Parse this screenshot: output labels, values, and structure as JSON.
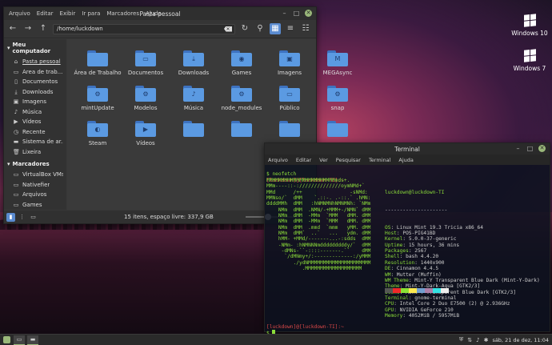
{
  "desktop": {
    "icons": [
      {
        "label": "Windows 10"
      },
      {
        "label": "Windows 7"
      }
    ]
  },
  "file_manager": {
    "title": "Pasta pessoal",
    "menu": [
      "Arquivo",
      "Editar",
      "Exibir",
      "Ir para",
      "Marcadores",
      "Ajuda"
    ],
    "path": "/home/luckdown",
    "sidebar": {
      "computer_header": "Meu computador",
      "computer_items": [
        {
          "label": "Pasta pessoal",
          "icon": "home-icon"
        },
        {
          "label": "Área de trab...",
          "icon": "desktop-icon"
        },
        {
          "label": "Documentos",
          "icon": "document-icon"
        },
        {
          "label": "Downloads",
          "icon": "download-icon"
        },
        {
          "label": "Imagens",
          "icon": "image-icon"
        },
        {
          "label": "Música",
          "icon": "music-icon"
        },
        {
          "label": "Vídeos",
          "icon": "video-icon"
        },
        {
          "label": "Recente",
          "icon": "clock-icon"
        },
        {
          "label": "Sistema de ar...",
          "icon": "drive-icon"
        },
        {
          "label": "Lixeira",
          "icon": "trash-icon"
        }
      ],
      "bookmarks_header": "Marcadores",
      "bookmark_items": [
        {
          "label": "VirtualBox VMs",
          "icon": "folder-icon"
        },
        {
          "label": "Nativefier",
          "icon": "folder-icon"
        },
        {
          "label": "Arquivos",
          "icon": "folder-icon"
        },
        {
          "label": "Games",
          "icon": "folder-icon"
        }
      ]
    },
    "files": [
      {
        "name": "Área de Trabalho",
        "emblem": ""
      },
      {
        "name": "Documentos",
        "emblem": "▭"
      },
      {
        "name": "Downloads",
        "emblem": "⤓"
      },
      {
        "name": "Games",
        "emblem": "◉"
      },
      {
        "name": "Imagens",
        "emblem": "▣"
      },
      {
        "name": "MEGAsync",
        "emblem": "M"
      },
      {
        "name": "mintUpdate",
        "emblem": "⚙"
      },
      {
        "name": "Modelos",
        "emblem": "⚙"
      },
      {
        "name": "Música",
        "emblem": "♪"
      },
      {
        "name": "node_modules",
        "emblem": "⚙"
      },
      {
        "name": "Público",
        "emblem": "▭"
      },
      {
        "name": "snap",
        "emblem": "⚙"
      },
      {
        "name": "Steam",
        "emblem": "◐"
      },
      {
        "name": "Vídeos",
        "emblem": "▶"
      },
      {
        "name": "",
        "emblem": ""
      },
      {
        "name": "",
        "emblem": ""
      },
      {
        "name": "",
        "emblem": ""
      },
      {
        "name": "",
        "emblem": ""
      }
    ],
    "status": "15 itens, espaço livre: 337,9 GB"
  },
  "terminal": {
    "title": "Terminal",
    "menu": [
      "Arquivo",
      "Editar",
      "Ver",
      "Pesquisar",
      "Terminal",
      "Ajuda"
    ],
    "prompt_line1": "[luckdown]@[luckdown-TI]:~",
    "command": "$ neofetch",
    "ascii": [
      "MMMMMMMMMMMMMMMMMMMMMMMmds+.",
      "MMm----::-://////////////oymNMd+`",
      "MMd      /++                -sNMd:",
      "MMNso/`  dMM    `.::-. .-::.` .hMN:",
      "ddddMMh  dMM   :hNMNMNhNMNMNh: `NMm",
      "    NMm  dMM  .NMN/-+MMM+-/NMN` dMM",
      "    NMm  dMM  -MMm  `MMM   dMM. dMM",
      "    NMm  dMM  -MMm  `MMM   dMM. dMM",
      "    NMm  dMM  .mmd  `mmm   yMM. dMM",
      "    NMm  dMM`  ..`   ...   ydm. dMM",
      "    hMM- +MMd/-------...-:sdds  dMM",
      "    -NMm- :hNMNNNmdddddddddy/`  dMM",
      "     -dMNs-``-::::-------.``    dMM",
      "      `/dMNmy+/:-------------:/yMMM",
      "         ./ydNMMMMMMMMMMMMMMMMMMMMM",
      "            .MMMMMMMMMMMMMMMMMMM"
    ],
    "user_host": "luckdown@luckdown-TI",
    "separator": "---------------------",
    "info": [
      {
        "key": "OS",
        "value": "Linux Mint 19.3 Tricia x86_64"
      },
      {
        "key": "Host",
        "value": "POS-PIG41BD"
      },
      {
        "key": "Kernel",
        "value": "5.0.0-37-generic"
      },
      {
        "key": "Uptime",
        "value": "15 hours, 36 mins"
      },
      {
        "key": "Packages",
        "value": "2567"
      },
      {
        "key": "Shell",
        "value": "bash 4.4.20"
      },
      {
        "key": "Resolution",
        "value": "1440x900"
      },
      {
        "key": "DE",
        "value": "Cinnamon 4.4.5"
      },
      {
        "key": "WM",
        "value": "Mutter (Muffin)"
      },
      {
        "key": "WM Theme",
        "value": "Mint-Y Transparent Blue Dark (Mint-Y-Dark)"
      },
      {
        "key": "Theme",
        "value": "Mint-Y-Dark-Aqua [GTK2/3]"
      },
      {
        "key": "Icons",
        "value": "Mint-Y Transparent Blue Dark [GTK2/3]"
      },
      {
        "key": "Terminal",
        "value": "gnome-terminal"
      },
      {
        "key": "CPU",
        "value": "Intel Core 2 Duo E7500 (2) @ 2.936GHz"
      },
      {
        "key": "GPU",
        "value": "NVIDIA GeForce 210"
      },
      {
        "key": "Memory",
        "value": "4052MiB / 5957MiB"
      }
    ],
    "palette": [
      "#3a3a3a",
      "#cc2222",
      "#4e9a06",
      "#c4a000",
      "#3465a4",
      "#75507b",
      "#06989a",
      "#d3d7cf",
      "#555753",
      "#ef2929",
      "#8ae234",
      "#fce94f",
      "#729fcf",
      "#ad7fa8",
      "#34e2e2",
      "#eeeeec"
    ],
    "prompt_line2": "[luckdown]@[luckdown-TI]:~",
    "prompt2": "$"
  },
  "panel": {
    "clock": "sáb, 21 de dez, 11:04"
  }
}
